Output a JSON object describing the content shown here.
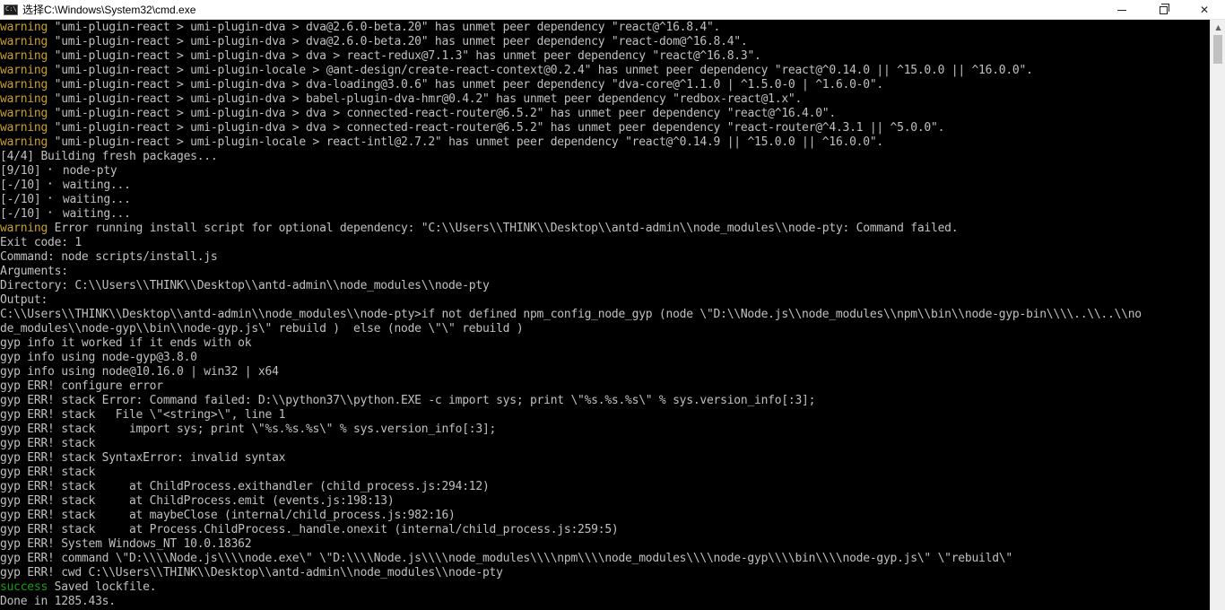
{
  "window": {
    "title": "选择C:\\Windows\\System32\\cmd.exe",
    "icon": "cmd-app-icon",
    "controls": {
      "minimize": "minimize-icon",
      "restore": "restore-icon",
      "close": "✕"
    }
  },
  "colors": {
    "background": "#000000",
    "text": "#c0c0c0",
    "warning": "#c9a227",
    "success": "#13a10e"
  },
  "console": {
    "lines": [
      {
        "prefix": "warning",
        "text": " \"umi-plugin-react > umi-plugin-dva > dva@2.6.0-beta.20\" has unmet peer dependency \"react@^16.8.4\"."
      },
      {
        "prefix": "warning",
        "text": " \"umi-plugin-react > umi-plugin-dva > dva@2.6.0-beta.20\" has unmet peer dependency \"react-dom@^16.8.4\"."
      },
      {
        "prefix": "warning",
        "text": " \"umi-plugin-react > umi-plugin-dva > dva > react-redux@7.1.3\" has unmet peer dependency \"react@^16.8.3\"."
      },
      {
        "prefix": "warning",
        "text": " \"umi-plugin-react > umi-plugin-locale > @ant-design/create-react-context@0.2.4\" has unmet peer dependency \"react@^0.14.0 || ^15.0.0 || ^16.0.0\"."
      },
      {
        "prefix": "warning",
        "text": " \"umi-plugin-react > umi-plugin-dva > dva-loading@3.0.6\" has unmet peer dependency \"dva-core@^1.1.0 | ^1.5.0-0 | ^1.6.0-0\"."
      },
      {
        "prefix": "warning",
        "text": " \"umi-plugin-react > umi-plugin-dva > babel-plugin-dva-hmr@0.4.2\" has unmet peer dependency \"redbox-react@1.x\"."
      },
      {
        "prefix": "warning",
        "text": " \"umi-plugin-react > umi-plugin-dva > dva > connected-react-router@6.5.2\" has unmet peer dependency \"react@^16.4.0\"."
      },
      {
        "prefix": "warning",
        "text": " \"umi-plugin-react > umi-plugin-dva > dva > connected-react-router@6.5.2\" has unmet peer dependency \"react-router@^4.3.1 || ^5.0.0\"."
      },
      {
        "prefix": "warning",
        "text": " \"umi-plugin-react > umi-plugin-locale > react-intl@2.7.2\" has unmet peer dependency \"react@^0.14.9 || ^15.0.0 || ^16.0.0\"."
      },
      {
        "prefix": "",
        "text": "[4/4] Building fresh packages..."
      },
      {
        "prefix": "",
        "text": "[9/10] ⠂ node-pty"
      },
      {
        "prefix": "",
        "text": "[-/10] ⠂ waiting..."
      },
      {
        "prefix": "",
        "text": "[-/10] ⠂ waiting..."
      },
      {
        "prefix": "",
        "text": "[-/10] ⠂ waiting..."
      },
      {
        "prefix": "warning",
        "text": " Error running install script for optional dependency: \"C:\\\\Users\\\\THINK\\\\Desktop\\\\antd-admin\\\\node_modules\\\\node-pty: Command failed."
      },
      {
        "prefix": "",
        "text": "Exit code: 1"
      },
      {
        "prefix": "",
        "text": "Command: node scripts/install.js"
      },
      {
        "prefix": "",
        "text": "Arguments:"
      },
      {
        "prefix": "",
        "text": "Directory: C:\\\\Users\\\\THINK\\\\Desktop\\\\antd-admin\\\\node_modules\\\\node-pty"
      },
      {
        "prefix": "",
        "text": "Output:"
      },
      {
        "prefix": "",
        "text": "C:\\\\Users\\\\THINK\\\\Desktop\\\\antd-admin\\\\node_modules\\\\node-pty>if not defined npm_config_node_gyp (node \\\"D:\\\\Node.js\\\\node_modules\\\\npm\\\\bin\\\\node-gyp-bin\\\\\\\\..\\\\..\\\\no"
      },
      {
        "prefix": "",
        "text": "de_modules\\\\node-gyp\\\\bin\\\\node-gyp.js\\\" rebuild )  else (node \\\"\\\" rebuild )"
      },
      {
        "prefix": "",
        "text": "gyp info it worked if it ends with ok"
      },
      {
        "prefix": "",
        "text": "gyp info using node-gyp@3.8.0"
      },
      {
        "prefix": "",
        "text": "gyp info using node@10.16.0 | win32 | x64"
      },
      {
        "prefix": "",
        "text": "gyp ERR! configure error"
      },
      {
        "prefix": "",
        "text": "gyp ERR! stack Error: Command failed: D:\\\\python37\\\\python.EXE -c import sys; print \\\"%s.%s.%s\\\" % sys.version_info[:3];"
      },
      {
        "prefix": "",
        "text": "gyp ERR! stack   File \\\"<string>\\\", line 1"
      },
      {
        "prefix": "",
        "text": "gyp ERR! stack     import sys; print \\\"%s.%s.%s\\\" % sys.version_info[:3];"
      },
      {
        "prefix": "",
        "text": "gyp ERR! stack"
      },
      {
        "prefix": "",
        "text": "gyp ERR! stack SyntaxError: invalid syntax"
      },
      {
        "prefix": "",
        "text": "gyp ERR! stack"
      },
      {
        "prefix": "",
        "text": "gyp ERR! stack     at ChildProcess.exithandler (child_process.js:294:12)"
      },
      {
        "prefix": "",
        "text": "gyp ERR! stack     at ChildProcess.emit (events.js:198:13)"
      },
      {
        "prefix": "",
        "text": "gyp ERR! stack     at maybeClose (internal/child_process.js:982:16)"
      },
      {
        "prefix": "",
        "text": "gyp ERR! stack     at Process.ChildProcess._handle.onexit (internal/child_process.js:259:5)"
      },
      {
        "prefix": "",
        "text": "gyp ERR! System Windows_NT 10.0.18362"
      },
      {
        "prefix": "",
        "text": "gyp ERR! command \\\"D:\\\\\\\\Node.js\\\\\\\\node.exe\\\" \\\"D:\\\\\\\\Node.js\\\\\\\\node_modules\\\\\\\\npm\\\\\\\\node_modules\\\\\\\\node-gyp\\\\\\\\bin\\\\\\\\node-gyp.js\\\" \\\"rebuild\\\""
      },
      {
        "prefix": "",
        "text": "gyp ERR! cwd C:\\\\Users\\\\THINK\\\\Desktop\\\\antd-admin\\\\node_modules\\\\node-pty"
      },
      {
        "prefix": "success",
        "text": " Saved lockfile."
      },
      {
        "prefix": "",
        "text": "Done in 1285.43s."
      }
    ]
  }
}
